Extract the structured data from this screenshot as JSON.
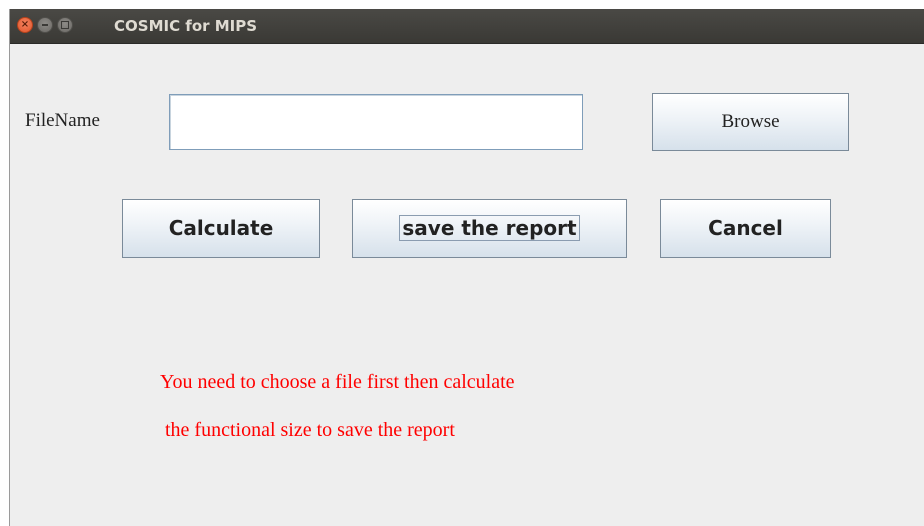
{
  "window": {
    "title": "COSMIC for MIPS",
    "close_glyph": "×"
  },
  "form": {
    "filename_label": "FileName",
    "filename_value": "",
    "browse_label": "Browse"
  },
  "actions": {
    "calculate_label": "Calculate",
    "save_label": "save the report",
    "cancel_label": "Cancel"
  },
  "message": {
    "line1": "You need to choose a file first then calculate",
    "line2": "the functional size to save the report",
    "color": "#ff0000"
  },
  "colors": {
    "window_bg": "#eeeeee",
    "titlebar": "#3c3b37",
    "close_button": "#e9592c"
  }
}
